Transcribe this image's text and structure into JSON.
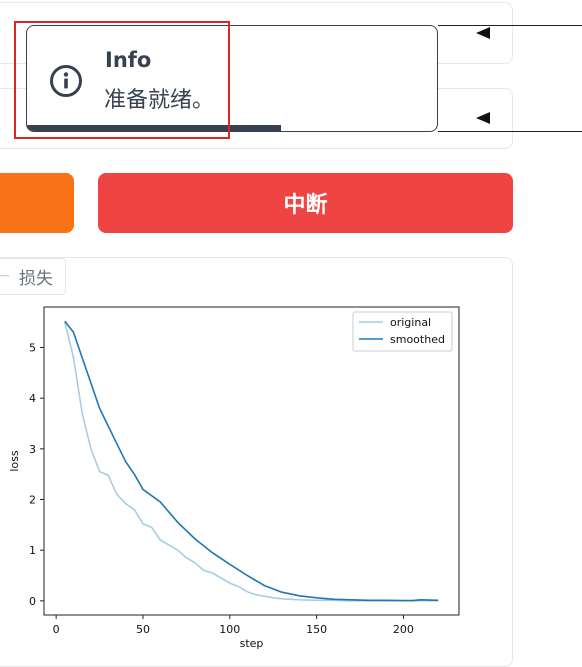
{
  "toast": {
    "title": "Info",
    "message": "准备就绪。",
    "progress_fraction": 0.62,
    "icon": "info-circle-icon"
  },
  "buttons": {
    "interrupt_label": "中断",
    "orange_label": ""
  },
  "tabs": {
    "loss_label": "损失"
  },
  "colors": {
    "orange": "#f97316",
    "red": "#ef4444",
    "toast_dark": "#374151",
    "original_line": "#a6cee3",
    "smoothed_line": "#1f78b4"
  },
  "chart_data": {
    "type": "line",
    "xlabel": "step",
    "ylabel": "loss",
    "xlim": [
      -7,
      232
    ],
    "ylim": [
      -0.28,
      5.8
    ],
    "x_ticks": [
      0,
      50,
      100,
      150,
      200
    ],
    "y_ticks": [
      0,
      1,
      2,
      3,
      4,
      5
    ],
    "legend": "top-right",
    "grid": false,
    "series": [
      {
        "name": "original",
        "x": [
          5,
          10,
          15,
          20,
          25,
          30,
          35,
          40,
          45,
          50,
          55,
          60,
          65,
          70,
          75,
          80,
          85,
          90,
          95,
          100,
          105,
          110,
          115,
          120,
          125,
          130,
          140,
          150,
          160,
          170,
          180,
          190,
          200,
          210,
          220
        ],
        "y": [
          5.5,
          4.8,
          3.7,
          3.0,
          2.55,
          2.48,
          2.1,
          1.92,
          1.8,
          1.52,
          1.45,
          1.2,
          1.1,
          1.0,
          0.85,
          0.75,
          0.6,
          0.55,
          0.45,
          0.35,
          0.28,
          0.18,
          0.12,
          0.09,
          0.06,
          0.04,
          0.02,
          0.01,
          0.01,
          0.0,
          0.0,
          0.0,
          0.0,
          0.0,
          0.0
        ]
      },
      {
        "name": "smoothed",
        "x": [
          5,
          10,
          15,
          20,
          25,
          30,
          35,
          40,
          45,
          50,
          60,
          70,
          80,
          90,
          100,
          110,
          120,
          130,
          140,
          150,
          160,
          170,
          180,
          190,
          200,
          205,
          210,
          220
        ],
        "y": [
          5.52,
          5.3,
          4.8,
          4.3,
          3.8,
          3.45,
          3.1,
          2.75,
          2.5,
          2.2,
          1.95,
          1.55,
          1.22,
          0.95,
          0.72,
          0.5,
          0.3,
          0.17,
          0.1,
          0.06,
          0.03,
          0.02,
          0.01,
          0.01,
          0.005,
          0.005,
          0.02,
          0.01
        ]
      }
    ]
  }
}
